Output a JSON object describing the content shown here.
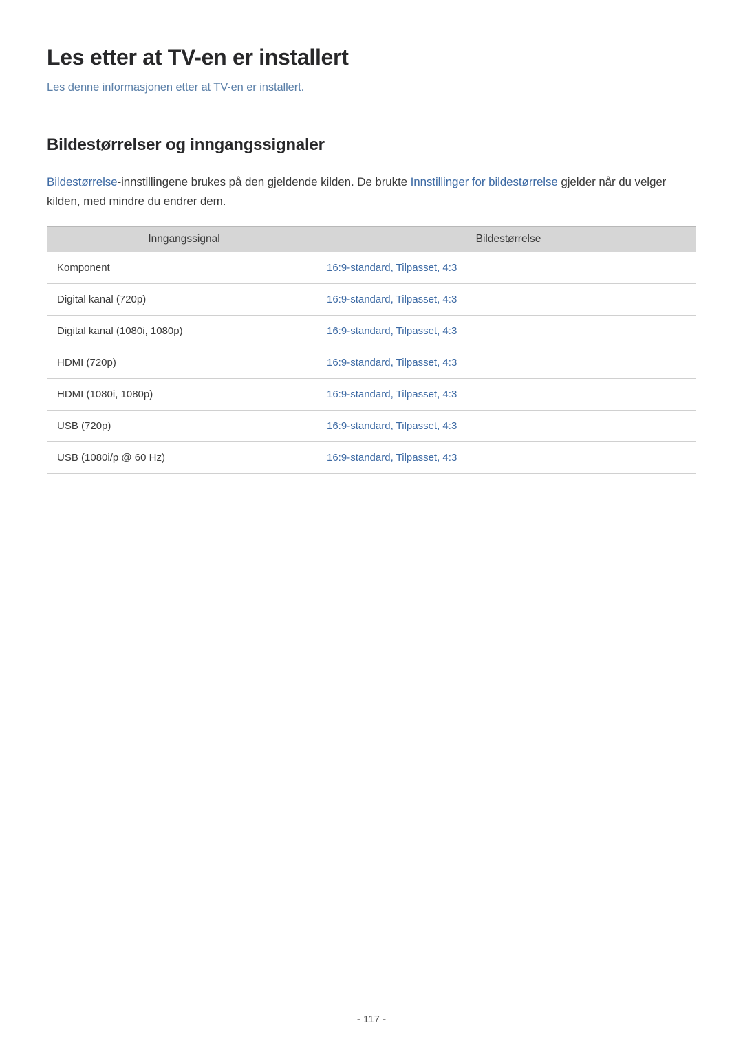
{
  "title": "Les etter at TV-en er installert",
  "subtitle": "Les denne informasjonen etter at TV-en er installert.",
  "section_heading": "Bildestørrelser og inngangssignaler",
  "intro": {
    "link1": "Bildestørrelse",
    "text1": "-innstillingene brukes på den gjeldende kilden. De brukte ",
    "link2": "Innstillinger for bildestørrelse",
    "text2": " gjelder når du velger kilden, med mindre du endrer dem."
  },
  "table": {
    "headers": [
      "Inngangssignal",
      "Bildestørrelse"
    ],
    "rows": [
      {
        "signal": "Komponent",
        "size": "16:9-standard, Tilpasset, 4:3"
      },
      {
        "signal": "Digital kanal (720p)",
        "size": "16:9-standard, Tilpasset, 4:3"
      },
      {
        "signal": "Digital kanal (1080i, 1080p)",
        "size": "16:9-standard, Tilpasset, 4:3"
      },
      {
        "signal": "HDMI (720p)",
        "size": "16:9-standard, Tilpasset, 4:3"
      },
      {
        "signal": "HDMI (1080i, 1080p)",
        "size": "16:9-standard, Tilpasset, 4:3"
      },
      {
        "signal": "USB (720p)",
        "size": "16:9-standard, Tilpasset, 4:3"
      },
      {
        "signal": "USB (1080i/p @ 60 Hz)",
        "size": "16:9-standard, Tilpasset, 4:3"
      }
    ]
  },
  "page_number": "- 117 -"
}
